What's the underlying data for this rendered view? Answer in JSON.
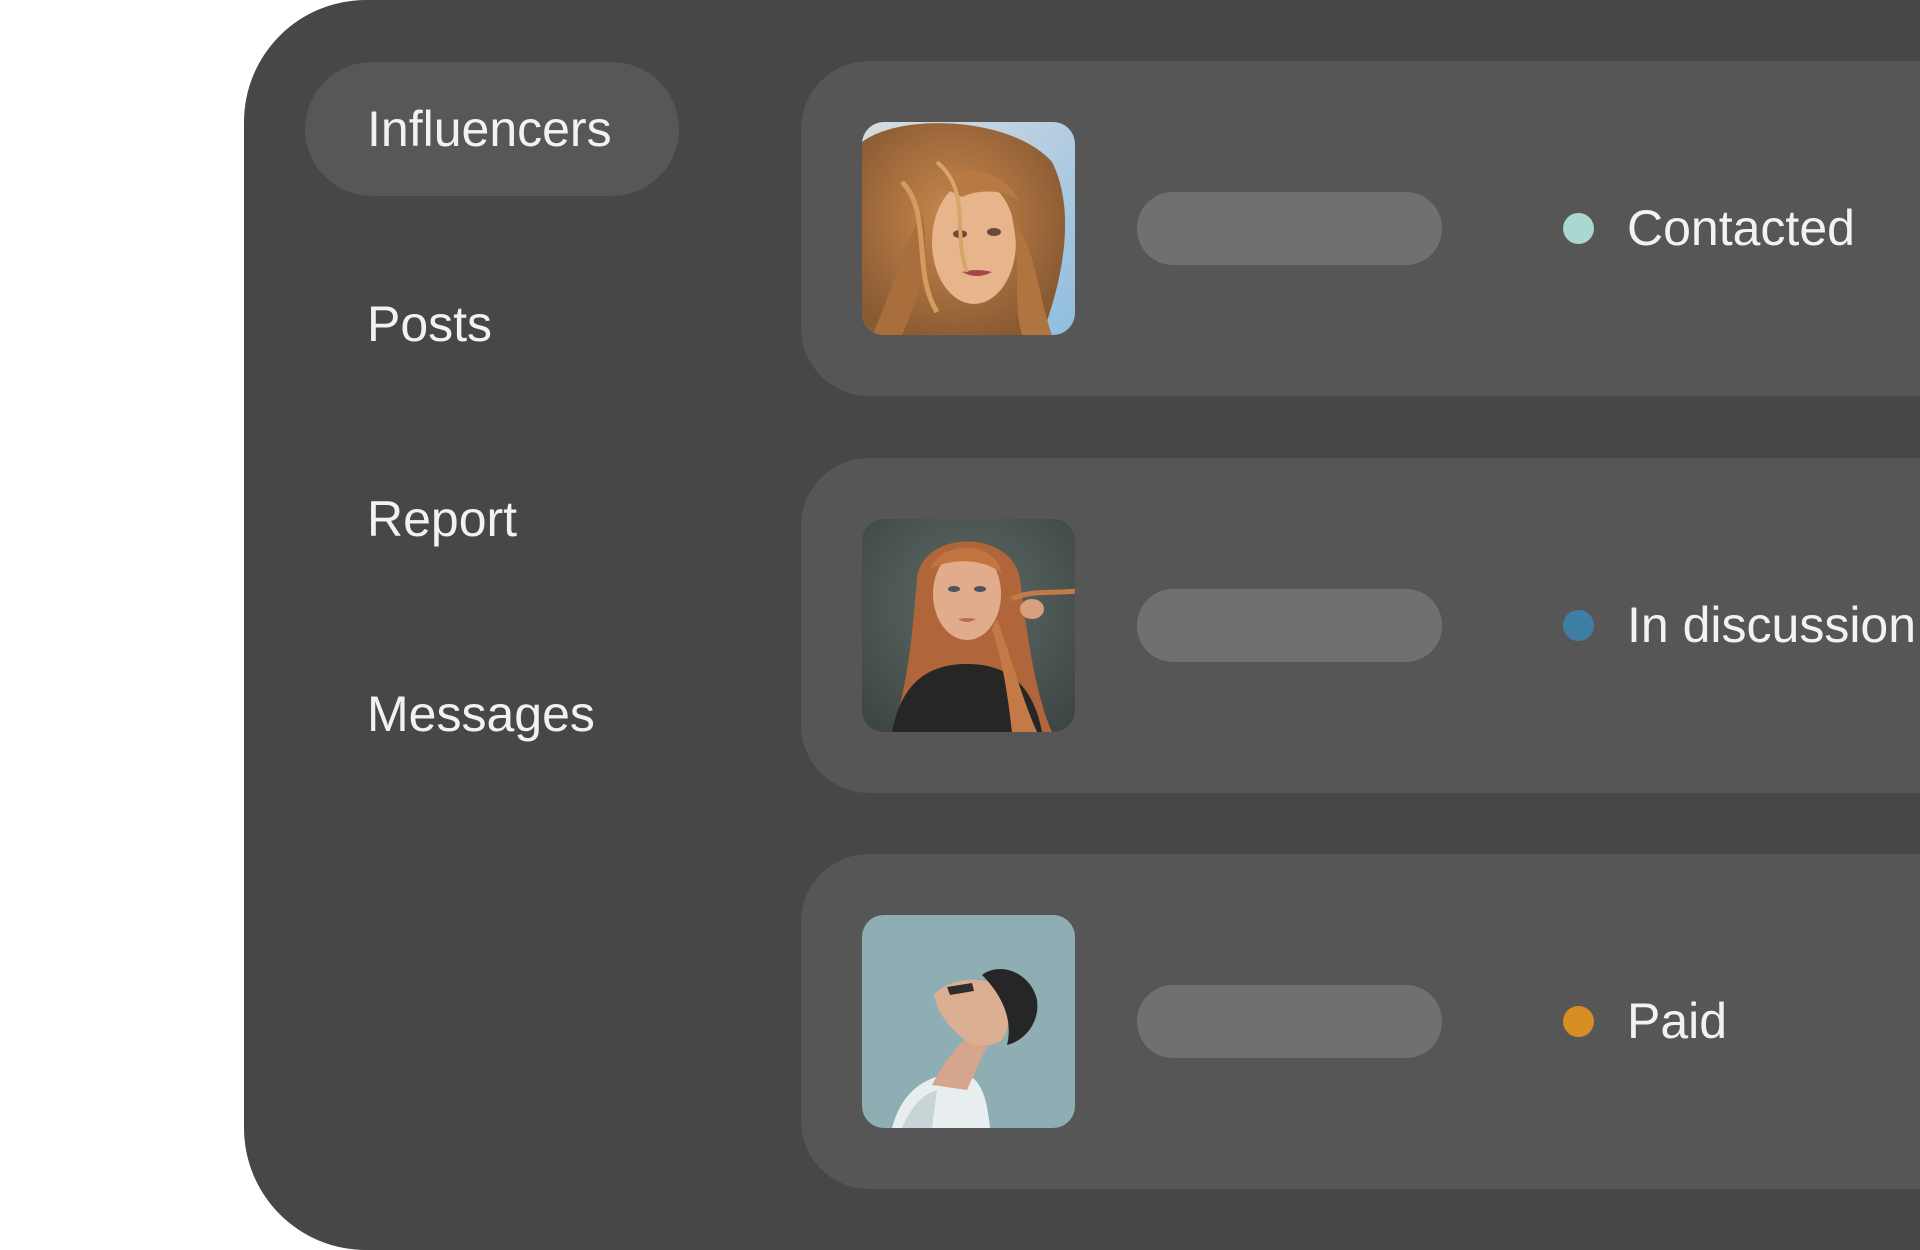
{
  "sidebar": {
    "items": [
      {
        "label": "Influencers",
        "active": true
      },
      {
        "label": "Posts",
        "active": false
      },
      {
        "label": "Report",
        "active": false
      },
      {
        "label": "Messages",
        "active": false
      }
    ]
  },
  "influencers": [
    {
      "avatar": "woman-wavy-blonde-hair-photo",
      "status": "Contacted",
      "status_color": "#a8d8d0"
    },
    {
      "avatar": "woman-long-red-hair-photo",
      "status": "In discussion",
      "status_color": "#3f7fa3"
    },
    {
      "avatar": "man-profile-looking-up-photo",
      "status": "Paid",
      "status_color": "#d98e24"
    }
  ],
  "colors": {
    "window_bg": "#474747",
    "card_bg": "#565656",
    "active_nav_bg": "#575757",
    "placeholder": "#707070",
    "text": "#f2f2f2"
  }
}
